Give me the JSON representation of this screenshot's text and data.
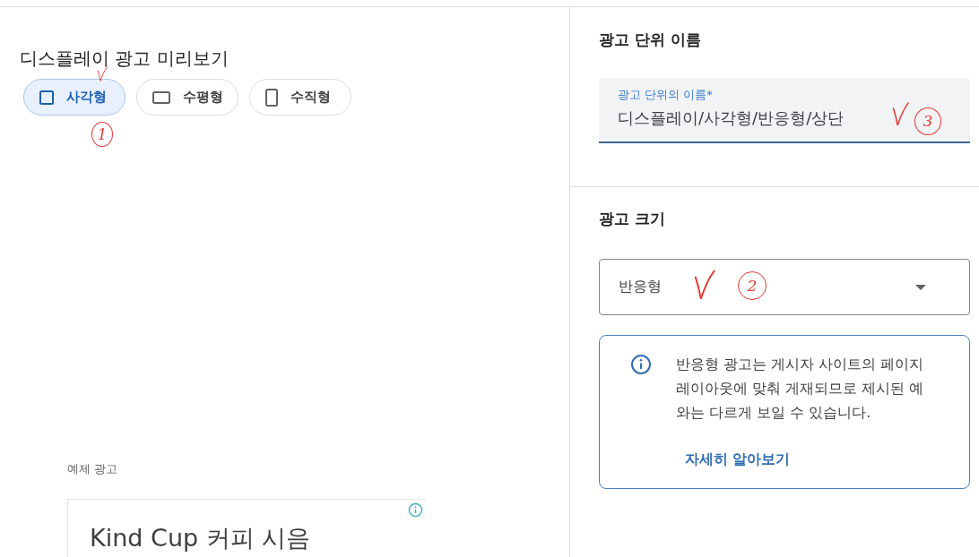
{
  "preview": {
    "title": "디스플레이 광고 미리보기",
    "formats": [
      {
        "label": "사각형",
        "kind": "square",
        "selected": true,
        "annotation": {
          "check": true,
          "number": "1"
        }
      },
      {
        "label": "수평형",
        "kind": "horizontal",
        "selected": false
      },
      {
        "label": "수직형",
        "kind": "vertical",
        "selected": false
      }
    ],
    "sample_label": "예제 광고",
    "sample_ad": {
      "headline": "Kind Cup 커피 시음"
    }
  },
  "ad_unit_name": {
    "heading": "광고 단위 이름",
    "field": {
      "label": "광고 단위의 이름*",
      "value": "디스플레이/사각형/반응형/상단",
      "focused": true,
      "annotation": {
        "check": true,
        "number": "3"
      }
    }
  },
  "ad_size": {
    "heading": "광고 크기",
    "select": {
      "value": "반응형",
      "annotation": {
        "check": true,
        "number": "2"
      }
    },
    "notice": {
      "text": "반응형 광고는 게시자 사이트의 페이지 레이아웃에 맞춰 게재되므로 제시된 예와는 다르게 보일 수 있습니다.",
      "link": "자세히 알아보기"
    }
  }
}
